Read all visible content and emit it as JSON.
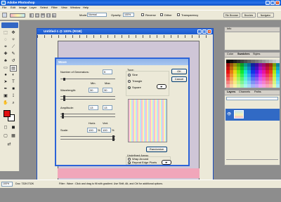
{
  "app": {
    "title": "Adobe Photoshop"
  },
  "menu": [
    "File",
    "Edit",
    "Image",
    "Layer",
    "Select",
    "Filter",
    "View",
    "Window",
    "Help"
  ],
  "options_bar": {
    "mode_label": "Mode:",
    "mode_value": "Normal",
    "opacity_label": "Opacity:",
    "opacity_value": "100%",
    "reverse_label": "Reverse",
    "dither_label": "Dither",
    "transparency_label": "Transparency",
    "tabs": [
      "File Browser",
      "Brushes",
      "Navigator"
    ]
  },
  "document": {
    "title": "Untitled-1 @ 100% (RGB)"
  },
  "wave_dialog": {
    "title": "Wave",
    "generators_label": "Number of Generators:",
    "generators_value": "5",
    "min_label": "Min.",
    "max_label": "Max.",
    "wavelength_label": "Wavelength:",
    "wavelength_min": "30",
    "wavelength_max": "30",
    "amplitude_label": "Amplitude:",
    "amplitude_min": "13",
    "amplitude_max": "13",
    "horiz_label": "Horiz.",
    "vert_label": "Vert.",
    "scale_label": "Scale:",
    "scale_horiz": "100",
    "scale_vert": "100",
    "percent": "%",
    "type_label": "Type:",
    "type_options": [
      "Sine",
      "Triangle",
      "Square"
    ],
    "type_selected": "Square",
    "ok_label": "OK",
    "cancel_label": "Cancel",
    "randomize_label": "Randomize",
    "undefined_areas_label": "Undefined Areas:",
    "area_options": [
      "Wrap Around",
      "Repeat Edge Pixels"
    ],
    "area_selected": "Repeat Edge Pixels"
  },
  "panels": {
    "info_tabs": [
      "Info"
    ],
    "swatch_tabs": [
      "Color",
      "Swatches",
      "Styles"
    ],
    "layer_tabs": [
      "Layers",
      "Channels",
      "Paths"
    ]
  },
  "status": {
    "zoom": "100%",
    "doc_size": "Doc: 732K/732K",
    "hint": "Filter : Wave : Click and drag to fill with gradient. Use Shift, Alt, and Ctrl for additional options."
  },
  "colors": {
    "foreground": "#e01010",
    "background": "#ffffff",
    "titlebar": "#0b5bd6"
  }
}
